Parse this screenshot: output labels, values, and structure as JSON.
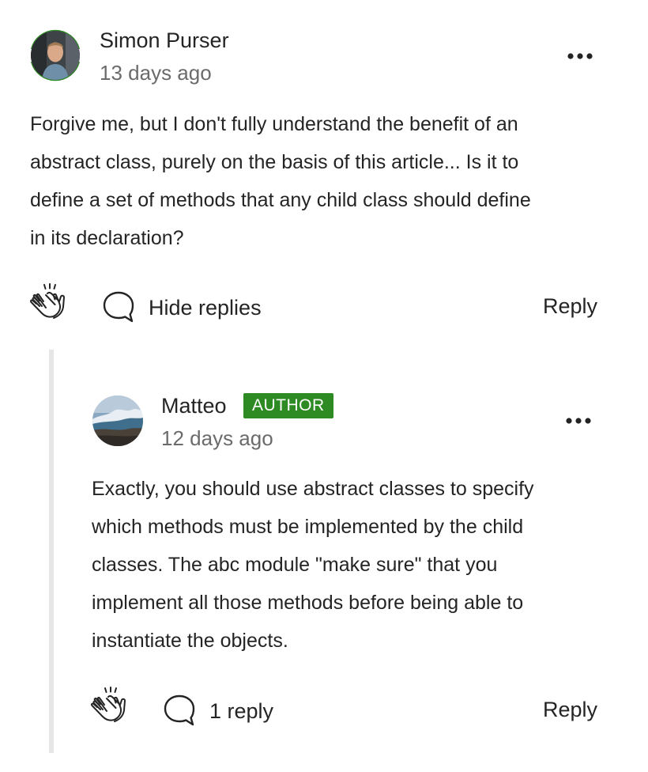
{
  "comment": {
    "author": "Simon Purser",
    "time": "13 days ago",
    "body_lines": [
      "Forgive me, but I don't fully understand the benefit of an",
      "abstract class, purely on the basis of this article... Is it to",
      "define a set of methods that any child class should define",
      "in its declaration?"
    ],
    "replies_toggle_label": "Hide replies",
    "reply_label": "Reply"
  },
  "reply": {
    "author": "Matteo",
    "badge": "AUTHOR",
    "time": "12 days ago",
    "body_lines": [
      "Exactly, you should use abstract classes to specify",
      "which methods must be implemented by the child",
      "classes. The abc module \"make sure\" that you",
      "implement all those methods before being able to",
      "instantiate the objects."
    ],
    "replies_count_label": "1 reply",
    "reply_label": "Reply"
  },
  "icons": {
    "more": "more-horizontal-icon",
    "clap": "clap-icon",
    "response": "speech-bubble-icon"
  },
  "colors": {
    "text": "#242424",
    "muted": "#6b6b6b",
    "author_badge": "#2e8b23",
    "avatar_ring": "#2e8b23",
    "thread_line": "#e6e6e6"
  }
}
